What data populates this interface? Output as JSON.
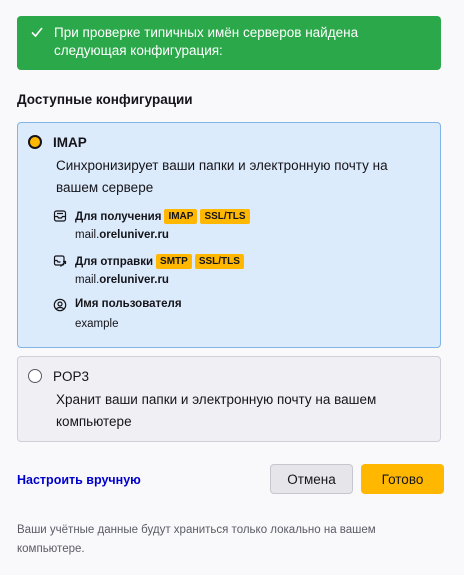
{
  "success_banner": {
    "text": "При проверке типичных имён серверов найдена следующая конфигурация:"
  },
  "section_title": "Доступные конфигурации",
  "configs": [
    {
      "protocol": "IMAP",
      "selected": true,
      "description": "Синхронизирует ваши папки и электронную почту на вашем сервере",
      "incoming": {
        "label": "Для получения",
        "badges": [
          "IMAP",
          "SSL/TLS"
        ],
        "server_prefix": "mail.",
        "server_domain": "oreluniver.ru"
      },
      "outgoing": {
        "label": "Для отправки",
        "badges": [
          "SMTP",
          "SSL/TLS"
        ],
        "server_prefix": "mail.",
        "server_domain": "oreluniver.ru"
      },
      "username": {
        "label": "Имя пользователя",
        "value": "example"
      }
    },
    {
      "protocol": "POP3",
      "selected": false,
      "description": "Хранит ваши папки и электронную почту на вашем компьютере"
    }
  ],
  "manual_link": "Настроить вручную",
  "buttons": {
    "cancel": "Отмена",
    "done": "Готово"
  },
  "footer_note": "Ваши учётные данные будут храниться только локально на вашем компьютере.",
  "colors": {
    "success": "#2ba84a",
    "accent": "#ffb700",
    "selected_card": "#dcebfb",
    "link": "#0000cc"
  }
}
